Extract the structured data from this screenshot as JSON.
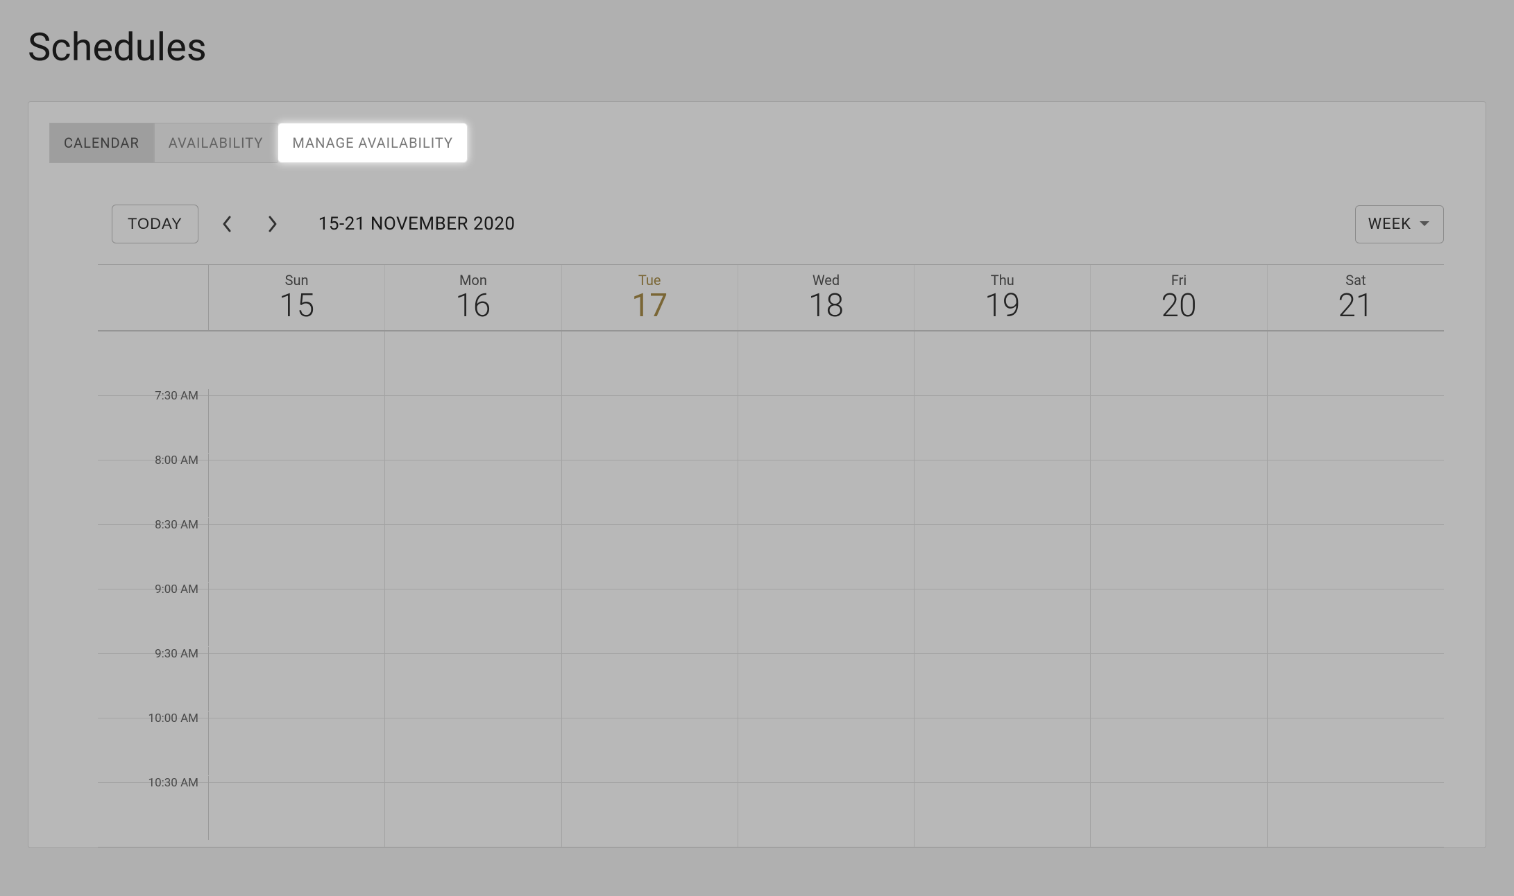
{
  "page_title": "Schedules",
  "tabs": [
    {
      "label": "CALENDAR",
      "state": "active"
    },
    {
      "label": "AVAILABILITY",
      "state": "normal"
    },
    {
      "label": "MANAGE AVAILABILITY",
      "state": "highlight"
    }
  ],
  "toolbar": {
    "today_label": "TODAY",
    "date_range": "15-21 NOVEMBER 2020",
    "view_label": "WEEK"
  },
  "days": [
    {
      "abbr": "Sun",
      "num": "15",
      "today": false
    },
    {
      "abbr": "Mon",
      "num": "16",
      "today": false
    },
    {
      "abbr": "Tue",
      "num": "17",
      "today": true
    },
    {
      "abbr": "Wed",
      "num": "18",
      "today": false
    },
    {
      "abbr": "Thu",
      "num": "19",
      "today": false
    },
    {
      "abbr": "Fri",
      "num": "20",
      "today": false
    },
    {
      "abbr": "Sat",
      "num": "21",
      "today": false
    }
  ],
  "time_slots": [
    "",
    "7:30 AM",
    "8:00 AM",
    "8:30 AM",
    "9:00 AM",
    "9:30 AM",
    "10:00 AM",
    "10:30 AM"
  ]
}
